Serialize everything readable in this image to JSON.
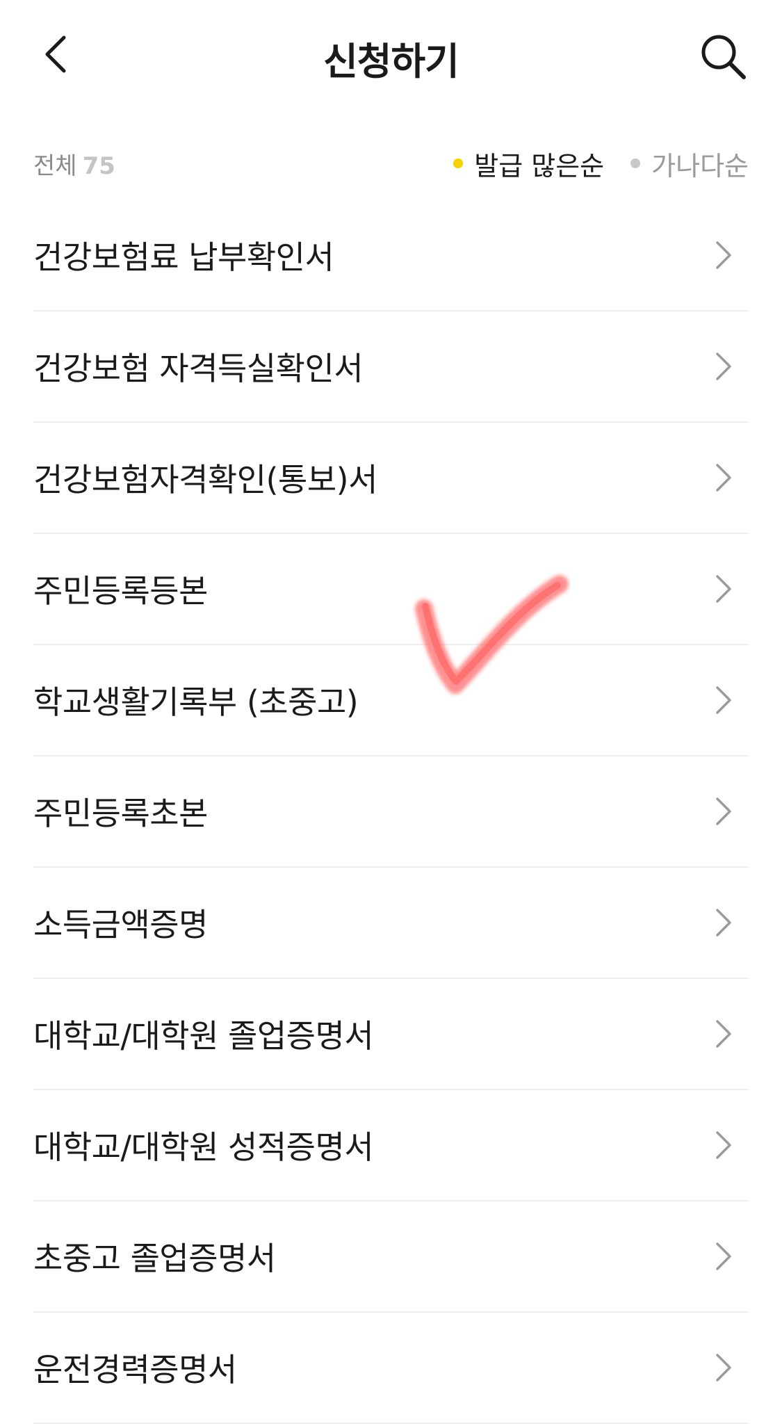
{
  "header": {
    "title": "신청하기",
    "back_icon": "chevron-left-icon",
    "search_icon": "search-icon"
  },
  "filter": {
    "total_label": "전체",
    "total_count": "75",
    "sort_options": [
      {
        "label": "발급 많은순",
        "selected": true,
        "dot_color": "#f5d200"
      },
      {
        "label": "가나다순",
        "selected": false,
        "dot_color": "#c8c8c8"
      }
    ]
  },
  "list": {
    "items": [
      {
        "label": "건강보험료 납부확인서"
      },
      {
        "label": "건강보험 자격득실확인서"
      },
      {
        "label": "건강보험자격확인(통보)서"
      },
      {
        "label": "주민등록등본"
      },
      {
        "label": "학교생활기록부 (초중고)"
      },
      {
        "label": "주민등록초본"
      },
      {
        "label": "소득금액증명"
      },
      {
        "label": "대학교/대학원 졸업증명서"
      },
      {
        "label": "대학교/대학원 성적증명서"
      },
      {
        "label": "초중고 졸업증명서"
      },
      {
        "label": "운전경력증명서"
      }
    ],
    "chevron_icon": "chevron-right-icon"
  },
  "annotation": {
    "icon": "red-checkmark-annotation",
    "color": "#ff5a5a"
  },
  "colors": {
    "accent_yellow": "#f5d200",
    "text_primary": "#1a1a1a",
    "text_muted": "#8a8a8a",
    "divider": "#eeeeee"
  }
}
